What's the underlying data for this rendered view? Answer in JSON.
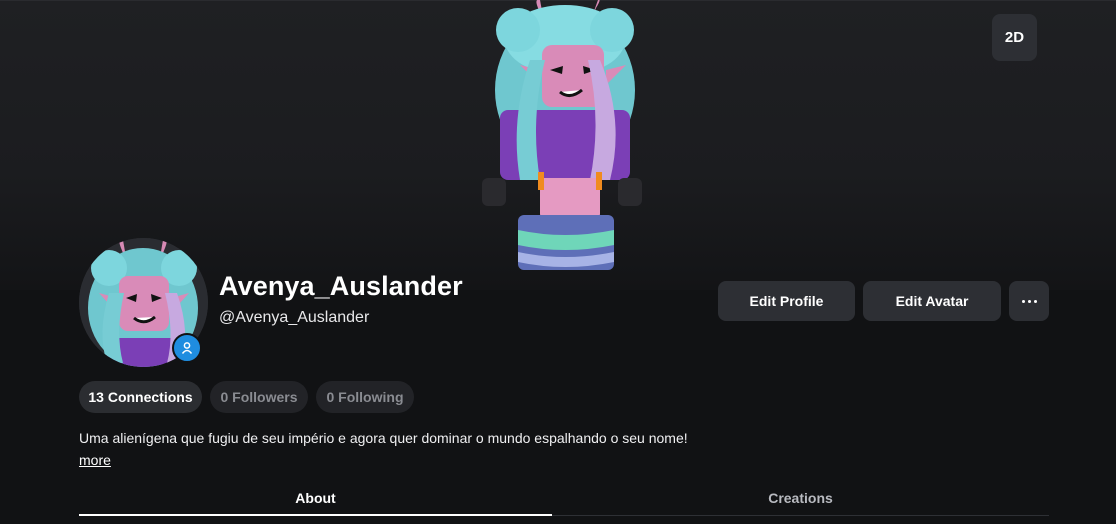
{
  "viewer": {
    "toggle_2d_label": "2D"
  },
  "profile": {
    "display_name": "Avenya_Auslander",
    "username": "@Avenya_Auslander",
    "bio": "Uma alienígena que fugiu de seu império e agora quer dominar o mundo espalhando o seu nome!",
    "more_label": "more"
  },
  "actions": {
    "edit_profile": "Edit Profile",
    "edit_avatar": "Edit Avatar",
    "more_icon": "ellipsis-icon"
  },
  "stats": {
    "connections": "13 Connections",
    "followers": "0 Followers",
    "following": "0 Following"
  },
  "tabs": [
    {
      "label": "About",
      "active": true
    },
    {
      "label": "Creations",
      "active": false
    }
  ],
  "colors": {
    "background": "#111214",
    "button": "#2d2f34",
    "status_badge": "#1f8de0",
    "hair": "#7fd3da",
    "skin": "#d98bb8",
    "shirt": "#7b3fb6"
  }
}
